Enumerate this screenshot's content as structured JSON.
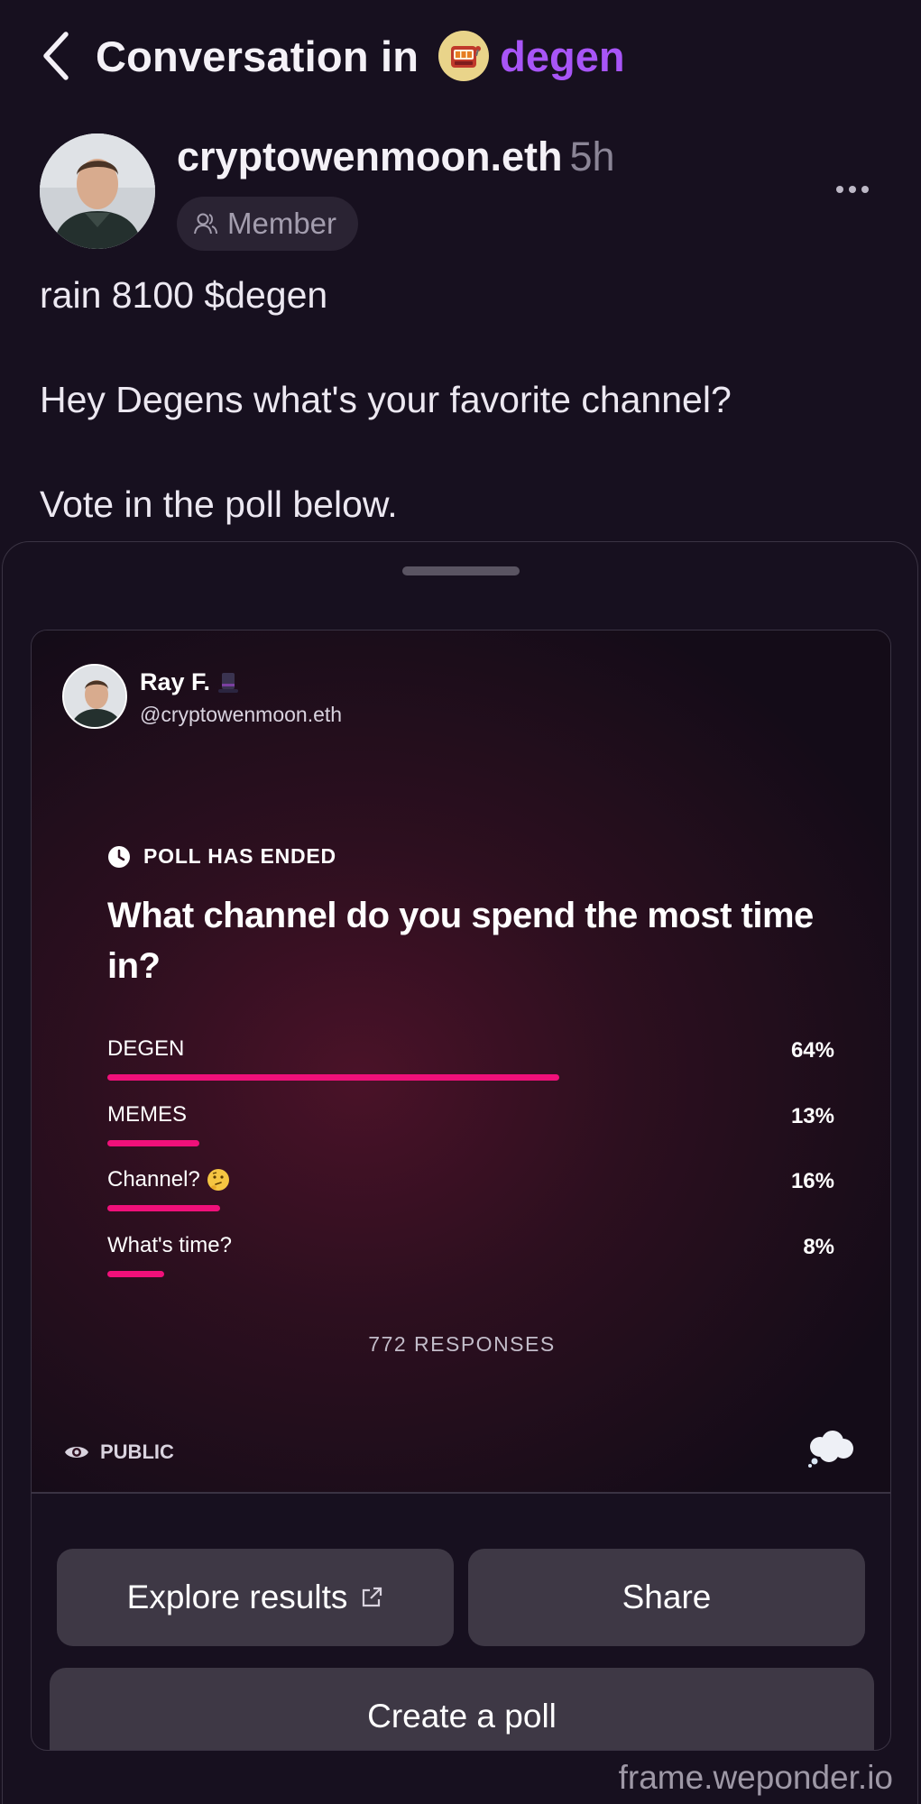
{
  "header": {
    "title": "Conversation in",
    "channel": "degen"
  },
  "post": {
    "author": "cryptowenmoon.eth",
    "age": "5h",
    "role": "Member",
    "lines": [
      "rain 8100 $degen",
      "Hey Degens what's your favorite channel?",
      "Vote in the poll below."
    ]
  },
  "frame": {
    "user_name": "Ray F.",
    "user_handle": "@cryptowenmoon.eth",
    "status": "POLL HAS ENDED",
    "question": "What channel do you spend the most time in?",
    "options": [
      {
        "label": "DEGEN",
        "pct": "64%",
        "value": 64
      },
      {
        "label": "MEMES",
        "pct": "13%",
        "value": 13
      },
      {
        "label": "Channel?",
        "pct": "16%",
        "value": 16
      },
      {
        "label": "What's time?",
        "pct": "8%",
        "value": 8
      }
    ],
    "responses": "772 RESPONSES",
    "visibility": "PUBLIC",
    "buttons": {
      "explore": "Explore results",
      "share": "Share",
      "create": "Create a poll"
    },
    "domain": "frame.weponder.io"
  },
  "icons": {
    "back": "chevron-left-icon",
    "channel": "slot-machine-icon",
    "member": "member-icon",
    "more": "more-dots-icon",
    "hat": "top-hat-icon",
    "clock": "clock-icon",
    "thinking": "thinking-face-icon",
    "eye": "eye-icon",
    "external": "external-link-icon",
    "cloud": "thought-cloud-icon"
  },
  "colors": {
    "background": "#17101f",
    "channel_accent": "#a855f7",
    "poll_bar": "#f0107a",
    "button_bg": "#3e3845"
  }
}
